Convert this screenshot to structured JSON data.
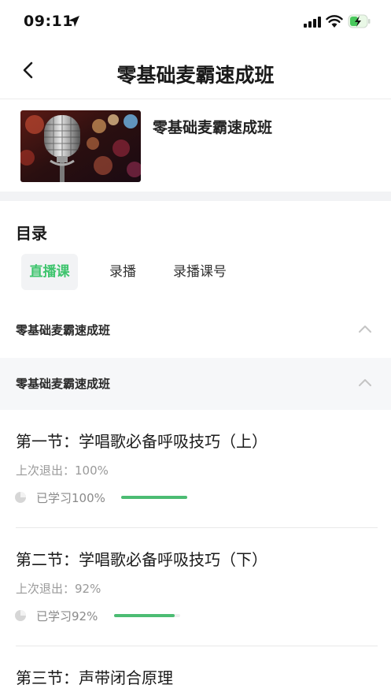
{
  "status_bar": {
    "time": "09:11"
  },
  "nav": {
    "title": "零基础麦霸速成班"
  },
  "course": {
    "title": "零基础麦霸速成班",
    "cover_icon": "microphone-image"
  },
  "catalog": {
    "heading": "目录",
    "tabs": [
      {
        "label": "直播课",
        "active": true
      },
      {
        "label": "录播",
        "active": false
      },
      {
        "label": "录播课号",
        "active": false
      }
    ],
    "groups": [
      {
        "label": "零基础麦霸速成班",
        "expanded": true
      },
      {
        "label": "零基础麦霸速成班",
        "expanded": true
      }
    ],
    "lessons": [
      {
        "title": "第一节：学唱歌必备呼吸技巧（上）",
        "last_exit": "上次退出：100%",
        "progress_label": "已学习100%",
        "progress": 1.0
      },
      {
        "title": "第二节：学唱歌必备呼吸技巧（下）",
        "last_exit": "上次退出：92%",
        "progress_label": "已学习92%",
        "progress": 0.92
      },
      {
        "title": "第三节：声带闭合原理"
      }
    ]
  },
  "colors": {
    "accent": "#3ec46d",
    "progress": "#4cbc73",
    "band": "#f2f3f5"
  }
}
